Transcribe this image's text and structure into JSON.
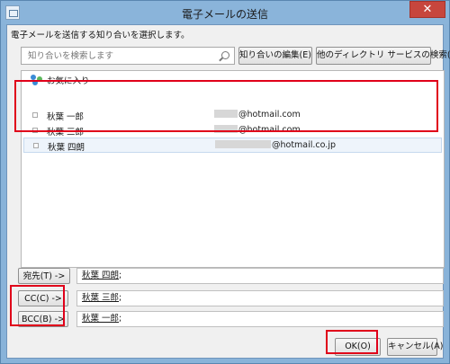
{
  "window": {
    "title": "電子メールの送信",
    "close_glyph": "✕"
  },
  "instruction": "電子メールを送信する知り合いを選択します。",
  "search": {
    "placeholder": "知り合いを検索します"
  },
  "buttons": {
    "edit_contacts": "知り合いの編集(E)",
    "search_directory": "他のディレクトリ サービスの検索(L)",
    "ok": "OK(O)",
    "cancel": "キャンセル(A)"
  },
  "group": {
    "label": "お気に入り"
  },
  "contacts": [
    {
      "name": "秋葉 一郎",
      "email_visible": "@hotmail.com",
      "selected": false
    },
    {
      "name": "秋葉 三郎",
      "email_visible": "@hotmail.com",
      "selected": false
    },
    {
      "name": "秋葉 四朗",
      "email_visible": "@hotmail.co.jp",
      "selected": true
    }
  ],
  "recipients": [
    {
      "button": "宛先(T) ->",
      "value": "秋葉 四朗",
      "sep": ";"
    },
    {
      "button": "CC(C) ->",
      "value": "秋葉 三郎",
      "sep": ";"
    },
    {
      "button": "BCC(B) ->",
      "value": "秋葉 一郎",
      "sep": ";"
    }
  ],
  "colors": {
    "highlight": "#e0001a",
    "titlebar": "#8ab4da",
    "close": "#c7463d"
  }
}
